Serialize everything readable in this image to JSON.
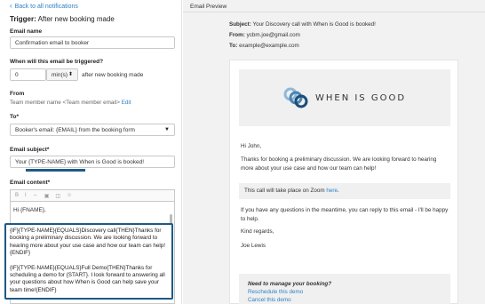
{
  "left": {
    "back_link": "Back to all notifications",
    "trigger_label": "Trigger:",
    "trigger_value": "After new booking made",
    "email_name_label": "Email name",
    "email_name_value": "Confirmation email to booker",
    "when_label": "When will this email be triggered?",
    "when_value": "0",
    "when_unit": "min(s)",
    "when_suffix": "after new booking made",
    "from_label": "From",
    "from_value": "Team member name <Team member email>",
    "from_edit": "Edit",
    "to_label": "To*",
    "to_value": "Booker's email: {EMAIL} from the booking form",
    "subject_label": "Email subject*",
    "subject_value": "Your {TYPE-NAME} with When is Good is booked!",
    "content_label": "Email content*",
    "toolbar": [
      "B",
      "I",
      "⇔",
      "▣",
      "◫",
      "☺"
    ],
    "content_greeting": "Hi {FNAME},",
    "content_para1": "{IF}{TYPE-NAME}{EQUALS}Discovery call{THEN}Thanks for booking a preliminary discussion. We are looking forward to hearing more about your use case and how our team can help!{ENDIF}",
    "content_para2": "{IF}{TYPE-NAME}{EQUALS}Full Demo{THEN}Thanks for scheduling a demo for {START}. I look forward to answering all your questions about how When is Good can help save your team time!{ENDIF}"
  },
  "right": {
    "preview_title": "Email Preview",
    "subject_label": "Subject:",
    "subject_value": "Your Discovery call with When is Good is booked!",
    "from_label": "From:",
    "from_value": "ycbm.joe@gmail.com",
    "to_label": "To:",
    "to_value": "example@example.com",
    "logo_text": "WHEN IS GOOD",
    "greeting": "Hi John,",
    "para1": "Thanks for booking a preliminary discussion. We are looking forward to hearing more about your use case and how our team can help!",
    "zoom_prefix": "This call will take place on Zoom",
    "zoom_link": "here",
    "zoom_suffix": ".",
    "para2": "If you have any questions in the meantime, you can reply to this email - I'll be happy to help.",
    "regards": "Kind regards,",
    "signature": "Joe Lewis",
    "manage_title": "Need to manage your booking?",
    "reschedule": "Reschedule this demo",
    "cancel": "Cancel this demo"
  }
}
